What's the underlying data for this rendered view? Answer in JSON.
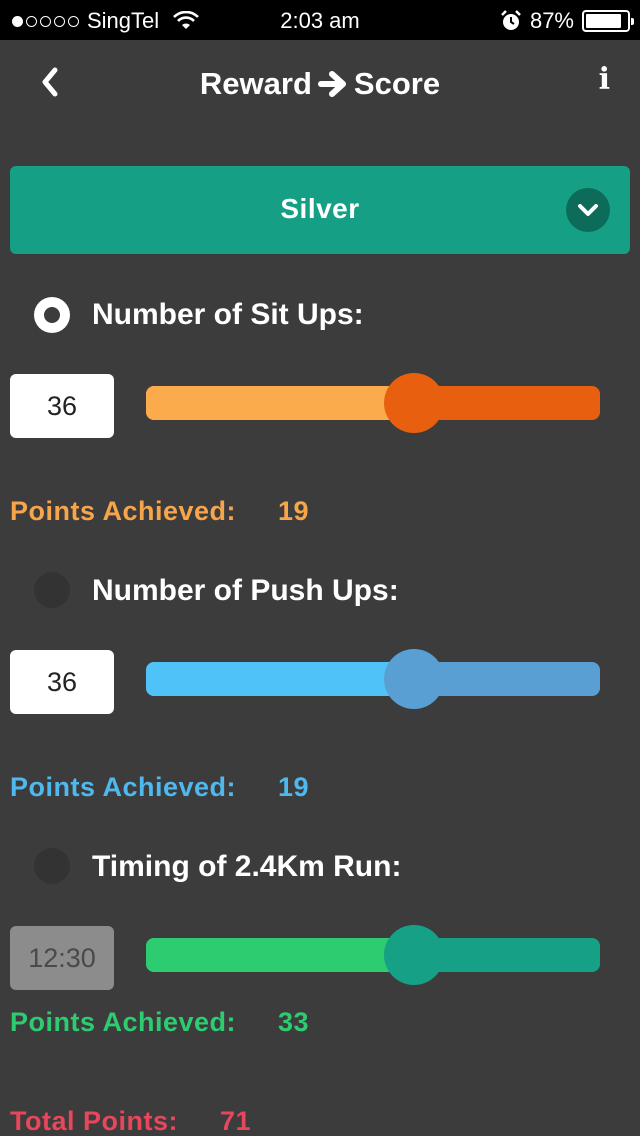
{
  "status_bar": {
    "carrier": "SingTel",
    "time": "2:03 am",
    "battery": "87%",
    "battery_level": 0.87,
    "signal_bars_filled": 1,
    "signal_bars_total": 5
  },
  "nav": {
    "title_left": "Reward",
    "title_right": "Score",
    "back_icon": "chevron-left-icon",
    "info_icon": "info-icon",
    "info_glyph": "i"
  },
  "level_dropdown": {
    "selected": "Silver",
    "color": "#15a085"
  },
  "sections": [
    {
      "label": "Number of Sit Ups:",
      "selected": true,
      "value": "36",
      "slider_fraction": 0.59,
      "points_label": "Points Achieved:",
      "points": "19",
      "colors": {
        "fill": "#fbab4c",
        "track": "#e8600f",
        "thumb": "#e8600f",
        "text": "#f7a54a"
      }
    },
    {
      "label": "Number of Push Ups:",
      "selected": false,
      "value": "36",
      "slider_fraction": 0.59,
      "points_label": "Points Achieved:",
      "points": "19",
      "colors": {
        "fill": "#4fc3f7",
        "track": "#5a9fd4",
        "thumb": "#5a9fd4",
        "text": "#4fb8ee"
      }
    },
    {
      "label": "Timing of 2.4Km Run:",
      "selected": false,
      "value": "12:30",
      "slider_fraction": 0.59,
      "points_label": "Points Achieved:",
      "points": "33",
      "colors": {
        "fill": "#2ecc71",
        "track": "#16a085",
        "thumb": "#16a085",
        "text": "#2ecc71"
      }
    }
  ],
  "total": {
    "label": "Total Points:",
    "value": "71",
    "color": "#e8465b"
  }
}
